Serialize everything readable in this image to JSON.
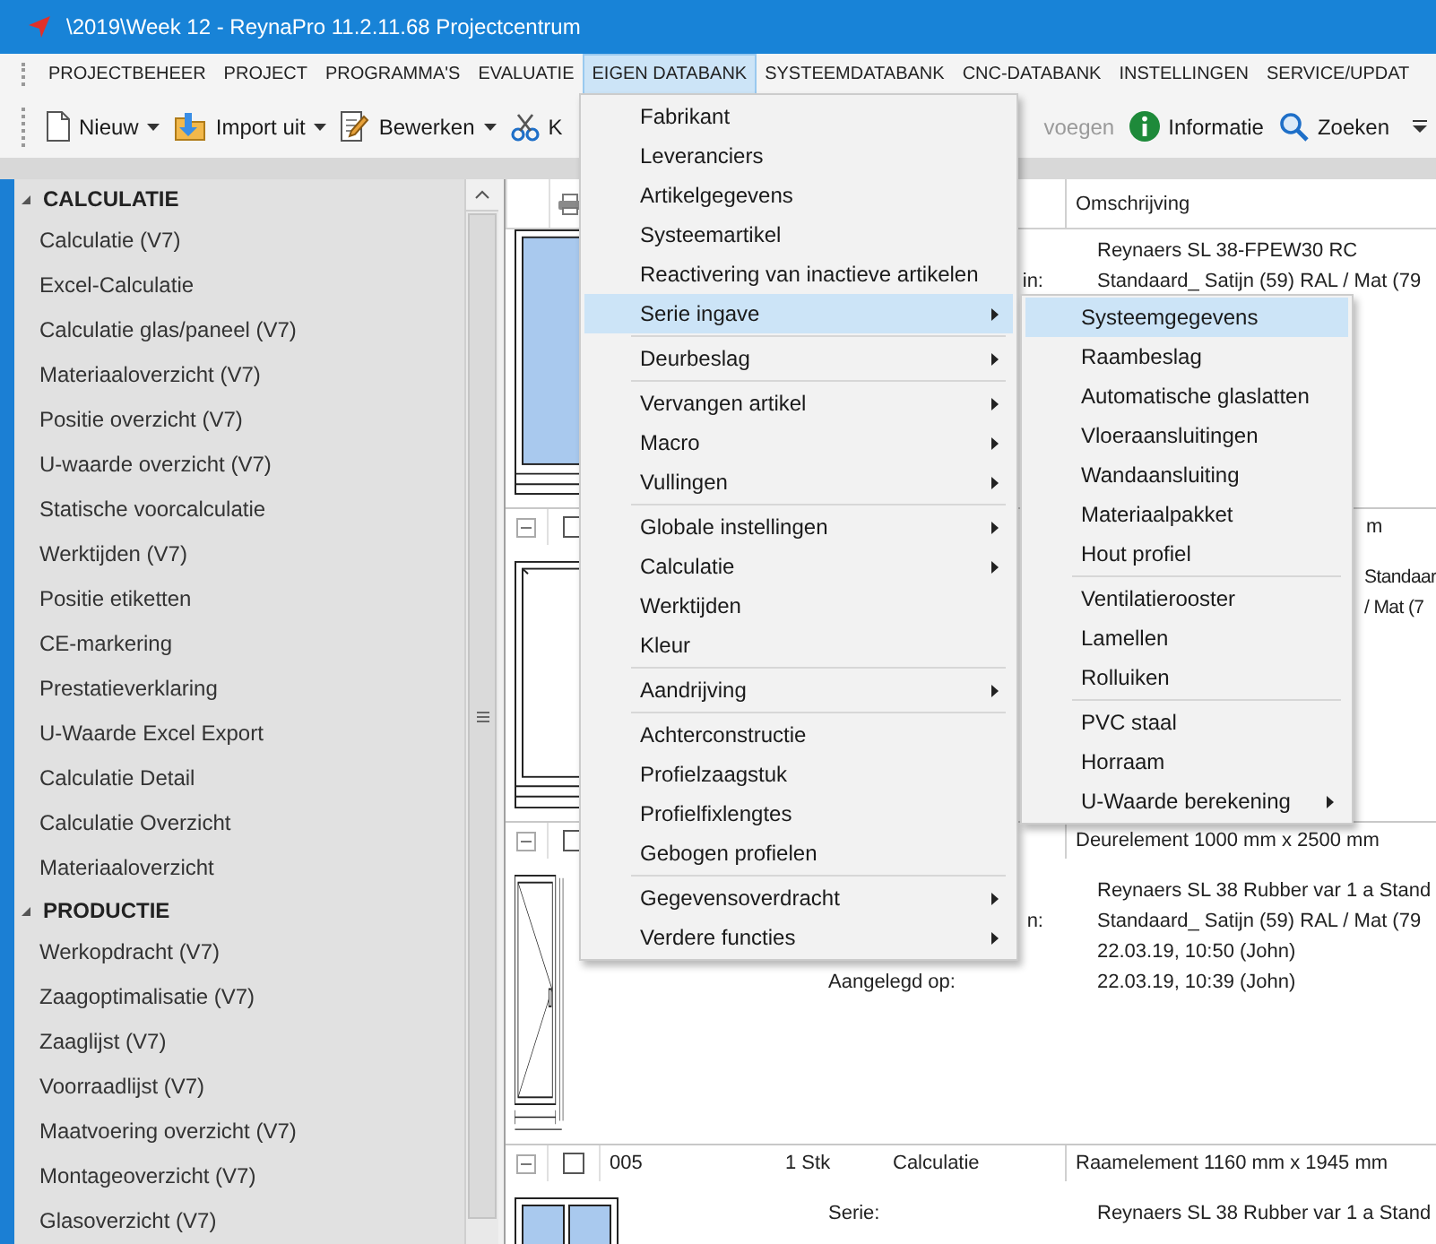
{
  "window": {
    "title": "\\2019\\Week 12 - ReynaPro 11.2.11.68 Projectcentrum"
  },
  "menubar": {
    "items": [
      {
        "label": "PROJECTBEHEER",
        "selected": false
      },
      {
        "label": "PROJECT",
        "selected": false
      },
      {
        "label": "PROGRAMMA'S",
        "selected": false
      },
      {
        "label": "EVALUATIE",
        "selected": false
      },
      {
        "label": "EIGEN DATABANK",
        "selected": true
      },
      {
        "label": "SYSTEEMDATABANK",
        "selected": false
      },
      {
        "label": "CNC-DATABANK",
        "selected": false
      },
      {
        "label": "INSTELLINGEN",
        "selected": false
      },
      {
        "label": "SERVICE/UPDAT",
        "selected": false
      }
    ]
  },
  "toolbar": {
    "left": [
      {
        "kind": "new",
        "label": "Nieuw",
        "dropdown": true,
        "disabled": false
      },
      {
        "kind": "import",
        "label": "Import uit",
        "dropdown": true,
        "disabled": false
      },
      {
        "kind": "edit",
        "label": "Bewerken",
        "dropdown": true,
        "disabled": false
      },
      {
        "kind": "cut",
        "label": "K",
        "dropdown": false,
        "disabled": false
      }
    ],
    "right": [
      {
        "kind": "plain",
        "label": "voegen",
        "dropdown": false,
        "disabled": true
      },
      {
        "kind": "info",
        "label": "Informatie",
        "dropdown": false,
        "disabled": false
      },
      {
        "kind": "search",
        "label": "Zoeken",
        "dropdown": false,
        "disabled": false
      }
    ]
  },
  "sidebar": {
    "groups": [
      {
        "title": "CALCULATIE",
        "expanded": true,
        "items": [
          {
            "label": "Calculatie (V7)",
            "selected": false
          },
          {
            "label": "Excel-Calculatie",
            "selected": false
          },
          {
            "label": "Calculatie glas/paneel (V7)",
            "selected": false
          },
          {
            "label": "Materiaaloverzicht (V7)",
            "selected": false
          },
          {
            "label": "Positie overzicht (V7)",
            "selected": false
          },
          {
            "label": "U-waarde overzicht (V7)",
            "selected": false
          },
          {
            "label": "Statische voorcalculatie",
            "selected": false
          },
          {
            "label": "Werktijden (V7)",
            "selected": false
          },
          {
            "label": "Positie etiketten",
            "selected": false
          },
          {
            "label": "CE-markering",
            "selected": false
          },
          {
            "label": "Prestatieverklaring",
            "selected": false
          },
          {
            "label": "U-Waarde Excel Export",
            "selected": false
          },
          {
            "label": "Calculatie Detail",
            "selected": false
          },
          {
            "label": "Calculatie Overzicht",
            "selected": false
          },
          {
            "label": "Materiaaloverzicht",
            "selected": false
          }
        ]
      },
      {
        "title": "PRODUCTIE",
        "expanded": true,
        "items": [
          {
            "label": "Werkopdracht (V7)",
            "selected": false
          },
          {
            "label": "Zaagoptimalisatie (V7)",
            "selected": false
          },
          {
            "label": "Zaaglijst (V7)",
            "selected": false
          },
          {
            "label": "Voorraadlijst (V7)",
            "selected": false
          },
          {
            "label": "Maatvoering overzicht (V7)",
            "selected": false
          },
          {
            "label": "Montageoverzicht (V7)",
            "selected": false
          },
          {
            "label": "Glasoverzicht (V7)",
            "selected": false
          }
        ]
      }
    ]
  },
  "grid": {
    "description_header": "Omschrijving",
    "rows": [
      {
        "kind": "glazed",
        "partial": false,
        "details": [
          {
            "value": "Reynaers SL 38-FPEW30  RC"
          },
          {
            "label": "in:",
            "label_cut": true,
            "value": "Standaard_ Satijn (59) RAL / Mat (79"
          }
        ]
      },
      {
        "kind": "frame",
        "partial": true,
        "expanded": true,
        "checked": false,
        "description": "m",
        "details": [
          {
            "value": "Standaar"
          },
          {
            "value": "/ Mat (7"
          }
        ]
      },
      {
        "kind": "door",
        "partial": false,
        "expanded": true,
        "checked": false,
        "description": "Deurelement 1000 mm x 2500 mm",
        "details": [
          {
            "value": "Reynaers SL 38 Rubber var 1 a Stand"
          },
          {
            "label": "n:",
            "label_cut": true,
            "value": "Standaard_ Satijn (59) RAL / Mat (79"
          },
          {
            "value": "22.03.19, 10:50 (John)"
          },
          {
            "label": "Aangelegd op:",
            "label_cut": false,
            "value": "22.03.19, 10:39 (John)"
          }
        ]
      },
      {
        "kind": "double",
        "partial": false,
        "expanded": true,
        "checked": false,
        "number": "005",
        "quantity": "1 Stk",
        "type": "Calculatie",
        "description": "Raamelement 1160 mm x 1945 mm",
        "details": [
          {
            "label": "Serie:",
            "label_cut": false,
            "value": "Reynaers SL 38 Rubber var 1 a Stand"
          }
        ]
      }
    ]
  },
  "menu": {
    "items": [
      {
        "kind": "item",
        "label": "Fabrikant",
        "has_submenu": false,
        "selected": false
      },
      {
        "kind": "item",
        "label": "Leveranciers",
        "has_submenu": false,
        "selected": false
      },
      {
        "kind": "item",
        "label": "Artikelgegevens",
        "has_submenu": false,
        "selected": false
      },
      {
        "kind": "item",
        "label": "Systeemartikel",
        "has_submenu": false,
        "selected": false
      },
      {
        "kind": "item",
        "label": "Reactivering van inactieve artikelen",
        "has_submenu": false,
        "selected": false
      },
      {
        "kind": "item",
        "label": "Serie ingave",
        "has_submenu": true,
        "selected": true
      },
      {
        "kind": "separator"
      },
      {
        "kind": "item",
        "label": "Deurbeslag",
        "has_submenu": true,
        "selected": false
      },
      {
        "kind": "separator"
      },
      {
        "kind": "item",
        "label": "Vervangen artikel",
        "has_submenu": true,
        "selected": false
      },
      {
        "kind": "item",
        "label": "Macro",
        "has_submenu": true,
        "selected": false
      },
      {
        "kind": "item",
        "label": "Vullingen",
        "has_submenu": true,
        "selected": false
      },
      {
        "kind": "separator"
      },
      {
        "kind": "item",
        "label": "Globale instellingen",
        "has_submenu": true,
        "selected": false
      },
      {
        "kind": "item",
        "label": "Calculatie",
        "has_submenu": true,
        "selected": false
      },
      {
        "kind": "item",
        "label": "Werktijden",
        "has_submenu": false,
        "selected": false
      },
      {
        "kind": "item",
        "label": "Kleur",
        "has_submenu": false,
        "selected": false
      },
      {
        "kind": "separator"
      },
      {
        "kind": "item",
        "label": "Aandrijving",
        "has_submenu": true,
        "selected": false
      },
      {
        "kind": "separator"
      },
      {
        "kind": "item",
        "label": "Achterconstructie",
        "has_submenu": false,
        "selected": false
      },
      {
        "kind": "item",
        "label": "Profielzaagstuk",
        "has_submenu": false,
        "selected": false
      },
      {
        "kind": "item",
        "label": "Profielfixlengtes",
        "has_submenu": false,
        "selected": false
      },
      {
        "kind": "item",
        "label": "Gebogen profielen",
        "has_submenu": false,
        "selected": false
      },
      {
        "kind": "separator"
      },
      {
        "kind": "item",
        "label": "Gegevensoverdracht",
        "has_submenu": true,
        "selected": false
      },
      {
        "kind": "item",
        "label": "Verdere functies",
        "has_submenu": true,
        "selected": false
      }
    ]
  },
  "submenu": {
    "items": [
      {
        "kind": "item",
        "label": "Systeemgegevens",
        "has_submenu": false,
        "selected": true
      },
      {
        "kind": "item",
        "label": "Raambeslag",
        "has_submenu": false,
        "selected": false
      },
      {
        "kind": "item",
        "label": "Automatische glaslatten",
        "has_submenu": false,
        "selected": false
      },
      {
        "kind": "item",
        "label": "Vloeraansluitingen",
        "has_submenu": false,
        "selected": false
      },
      {
        "kind": "item",
        "label": "Wandaansluiting",
        "has_submenu": false,
        "selected": false
      },
      {
        "kind": "item",
        "label": "Materiaalpakket",
        "has_submenu": false,
        "selected": false
      },
      {
        "kind": "item",
        "label": "Hout profiel",
        "has_submenu": false,
        "selected": false
      },
      {
        "kind": "separator"
      },
      {
        "kind": "item",
        "label": "Ventilatierooster",
        "has_submenu": false,
        "selected": false
      },
      {
        "kind": "item",
        "label": "Lamellen",
        "has_submenu": false,
        "selected": false
      },
      {
        "kind": "item",
        "label": "Rolluiken",
        "has_submenu": false,
        "selected": false
      },
      {
        "kind": "separator"
      },
      {
        "kind": "item",
        "label": "PVC staal",
        "has_submenu": false,
        "selected": false
      },
      {
        "kind": "item",
        "label": "Horraam",
        "has_submenu": false,
        "selected": false
      },
      {
        "kind": "item",
        "label": "U-Waarde berekening",
        "has_submenu": true,
        "selected": false
      }
    ]
  }
}
